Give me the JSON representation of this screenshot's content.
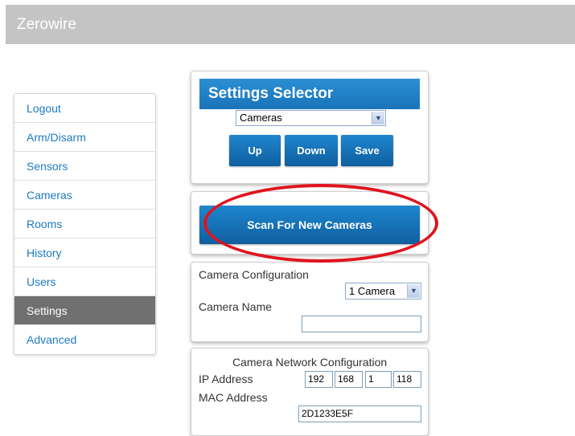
{
  "app": {
    "title": "Zerowire"
  },
  "sidebar": {
    "items": [
      {
        "label": "Logout"
      },
      {
        "label": "Arm/Disarm"
      },
      {
        "label": "Sensors"
      },
      {
        "label": "Cameras"
      },
      {
        "label": "Rooms"
      },
      {
        "label": "History"
      },
      {
        "label": "Users"
      },
      {
        "label": "Settings"
      },
      {
        "label": "Advanced"
      }
    ],
    "active": "Settings"
  },
  "settings_selector": {
    "title": "Settings Selector",
    "selected": "Cameras",
    "buttons": {
      "up": "Up",
      "down": "Down",
      "save": "Save"
    }
  },
  "scan": {
    "button_label": "Scan For New Cameras"
  },
  "camera_config": {
    "title": "Camera Configuration",
    "count_selected": "1 Camera",
    "name_label": "Camera Name",
    "name_value": ""
  },
  "network_config": {
    "title": "Camera Network Configuration",
    "ip_label": "IP Address",
    "ip": [
      "192",
      "168",
      "1",
      "118"
    ],
    "mac_label": "MAC Address",
    "mac_value": "2D1233E5F"
  },
  "colors": {
    "header_bar": "#c4c4c4",
    "accent_blue": "#1a73b8",
    "link_blue": "#1f7ac2",
    "active_nav": "#707070",
    "highlight_red": "#e0141e"
  },
  "icons": {
    "dropdown": "chevron-down-icon"
  }
}
